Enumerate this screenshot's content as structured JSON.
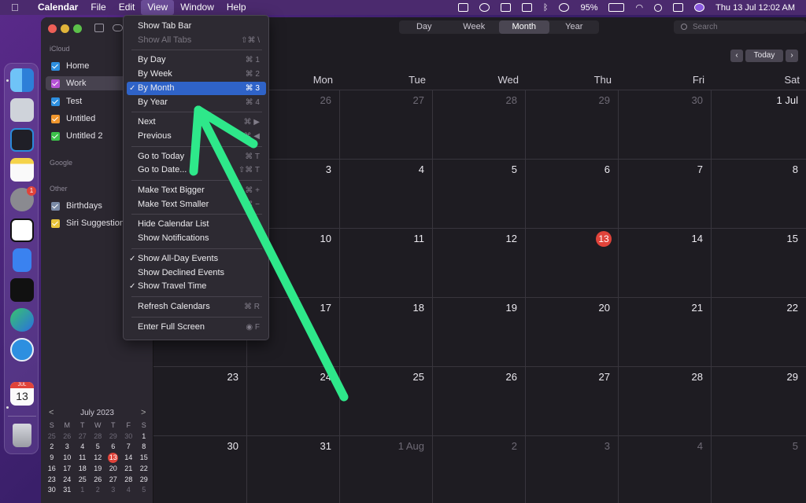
{
  "menubar": {
    "app_name": "Calendar",
    "items": [
      "File",
      "Edit",
      "View",
      "Window",
      "Help"
    ],
    "battery": "95%",
    "datetime": "Thu 13 Jul  12:02 AM"
  },
  "toolbar": {
    "views": [
      "Day",
      "Week",
      "Month",
      "Year"
    ],
    "active_view": "Month",
    "search_placeholder": "Search",
    "today_label": "Today"
  },
  "sidebar": {
    "sections": [
      {
        "title": "iCloud",
        "items": [
          {
            "label": "Home",
            "color": "#2d8fe0"
          },
          {
            "label": "Work",
            "color": "#b552d6"
          },
          {
            "label": "Test",
            "color": "#2d8fe0"
          },
          {
            "label": "Untitled",
            "color": "#f0962d"
          },
          {
            "label": "Untitled 2",
            "color": "#3cc24a"
          }
        ]
      },
      {
        "title": "Google",
        "items": []
      },
      {
        "title": "Other",
        "items": [
          {
            "label": "Birthdays",
            "color": "#7a8aa6"
          },
          {
            "label": "Siri Suggestions",
            "color": "#e8c43a"
          }
        ]
      }
    ]
  },
  "mini_calendar": {
    "title": "July 2023",
    "prev": "<",
    "next": ">",
    "weekdays": [
      "S",
      "M",
      "T",
      "W",
      "T",
      "F",
      "S"
    ],
    "weeks": [
      [
        "25",
        "26",
        "27",
        "28",
        "29",
        "30",
        "1"
      ],
      [
        "2",
        "3",
        "4",
        "5",
        "6",
        "7",
        "8"
      ],
      [
        "9",
        "10",
        "11",
        "12",
        "13",
        "14",
        "15"
      ],
      [
        "16",
        "17",
        "18",
        "19",
        "20",
        "21",
        "22"
      ],
      [
        "23",
        "24",
        "25",
        "26",
        "27",
        "28",
        "29"
      ],
      [
        "30",
        "31",
        "1",
        "2",
        "3",
        "4",
        "5"
      ]
    ],
    "today": "13"
  },
  "calendar": {
    "weekday_headers": [
      "Mon",
      "Tue",
      "Wed",
      "Thu",
      "Fri",
      "Sat"
    ],
    "weeks": [
      [
        "26",
        "27",
        "28",
        "29",
        "30",
        "1 Jul"
      ],
      [
        "3",
        "4",
        "5",
        "6",
        "7",
        "8"
      ],
      [
        "10",
        "11",
        "12",
        "13",
        "14",
        "15"
      ],
      [
        "17",
        "18",
        "19",
        "20",
        "21",
        "22"
      ],
      [
        "24",
        "25",
        "26",
        "27",
        "28",
        "29"
      ],
      [
        "31",
        "1 Aug",
        "2",
        "3",
        "4",
        "5"
      ]
    ],
    "sunday_visible": [
      "",
      "",
      "",
      "",
      "23",
      "30"
    ],
    "today": "13"
  },
  "view_menu": {
    "items": [
      {
        "label": "Show Tab Bar",
        "shortcut": ""
      },
      {
        "label": "Show All Tabs",
        "shortcut": "⇧⌘ \\",
        "disabled": true
      },
      {
        "sep": true
      },
      {
        "label": "By Day",
        "shortcut": "⌘ 1"
      },
      {
        "label": "By Week",
        "shortcut": "⌘ 2"
      },
      {
        "label": "By Month",
        "shortcut": "⌘ 3",
        "checked": true,
        "highlighted": true
      },
      {
        "label": "By Year",
        "shortcut": "⌘ 4"
      },
      {
        "sep": true
      },
      {
        "label": "Next",
        "shortcut": "⌘ ▶"
      },
      {
        "label": "Previous",
        "shortcut": "⌘ ◀"
      },
      {
        "sep": true
      },
      {
        "label": "Go to Today",
        "shortcut": "⌘ T"
      },
      {
        "label": "Go to Date...",
        "shortcut": "⇧⌘ T"
      },
      {
        "sep": true
      },
      {
        "label": "Make Text Bigger",
        "shortcut": "⌘ +"
      },
      {
        "label": "Make Text Smaller",
        "shortcut": "⌘ −"
      },
      {
        "sep": true
      },
      {
        "label": "Hide Calendar List",
        "shortcut": ""
      },
      {
        "label": "Show Notifications",
        "shortcut": ""
      },
      {
        "sep": true
      },
      {
        "label": "Show All-Day Events",
        "shortcut": "",
        "checked": true
      },
      {
        "label": "Show Declined Events",
        "shortcut": ""
      },
      {
        "label": "Show Travel Time",
        "shortcut": "",
        "checked": true
      },
      {
        "sep": true
      },
      {
        "label": "Refresh Calendars",
        "shortcut": "⌘ R"
      },
      {
        "sep": true
      },
      {
        "label": "Enter Full Screen",
        "shortcut": "◉ F"
      }
    ]
  },
  "dock": {
    "apps": [
      "Finder",
      "Launchpad",
      "Visual Studio Code",
      "Notes",
      "System Settings",
      "Notion",
      "Google Docs",
      "Apple TV",
      "Microsoft Edge",
      "Safari",
      "Calendar",
      "Trash"
    ],
    "settings_badge": "1",
    "calendar_month": "JUL",
    "calendar_day": "13"
  },
  "annotation": {
    "color": "#2ee88a"
  }
}
